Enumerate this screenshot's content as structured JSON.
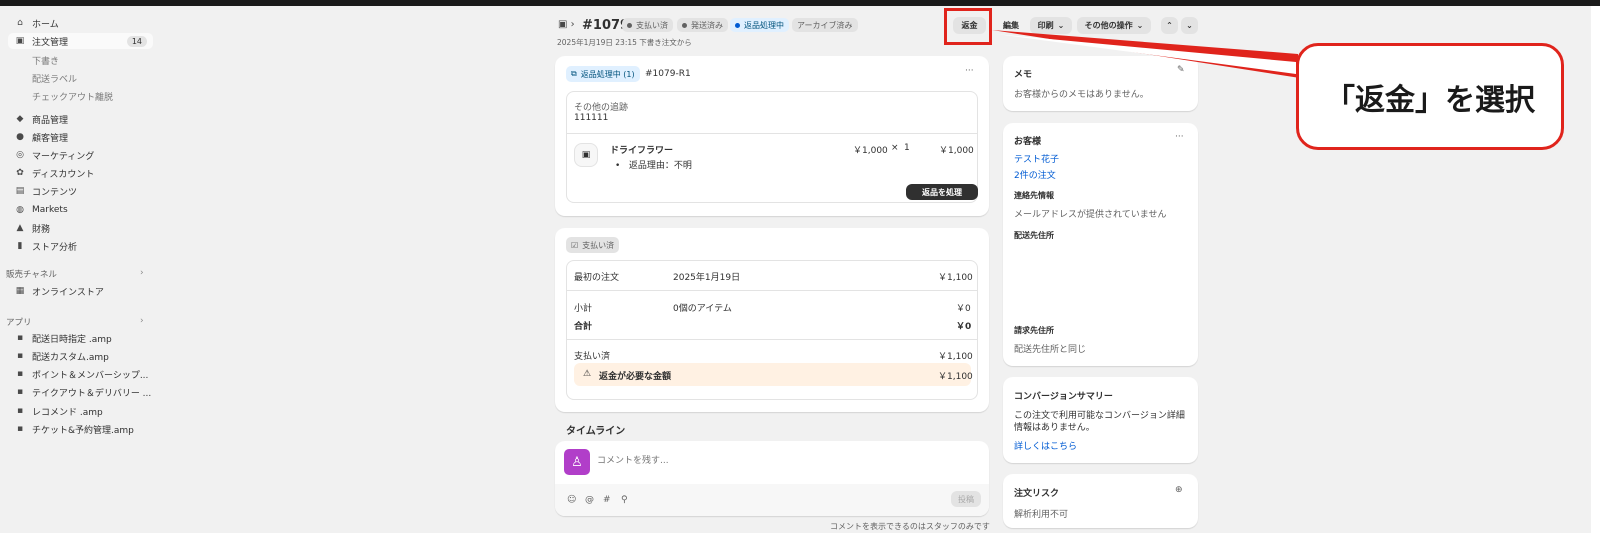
{
  "sidebar": {
    "items": [
      {
        "label": "ホーム",
        "icon": "home-icon"
      },
      {
        "label": "注文管理",
        "icon": "inbox-icon",
        "badge": "14"
      },
      {
        "label": "商品管理",
        "icon": "tag-icon"
      },
      {
        "label": "顧客管理",
        "icon": "person-icon"
      },
      {
        "label": "マーケティング",
        "icon": "target-icon"
      },
      {
        "label": "ディスカウント",
        "icon": "discount-icon"
      },
      {
        "label": "コンテンツ",
        "icon": "content-icon"
      },
      {
        "label": "Markets",
        "icon": "globe-icon"
      },
      {
        "label": "財務",
        "icon": "bank-icon"
      },
      {
        "label": "ストア分析",
        "icon": "chart-bar-icon"
      }
    ],
    "order_subitems": [
      "下書き",
      "配送ラベル",
      "チェックアウト離脱"
    ],
    "sales_channels_label": "販売チャネル",
    "online_store": "オンラインストア",
    "apps_label": "アプリ",
    "apps": [
      "配送日時指定 .amp",
      "配送カスタム.amp",
      "ポイント＆メンバーシップ...",
      "テイクアウト＆デリバリー ...",
      "レコメンド .amp",
      "チケット&予約管理.amp"
    ]
  },
  "header": {
    "order_number": "#1079",
    "pills": [
      "支払い済",
      "発送済み",
      "返品処理中",
      "アーカイブ済み"
    ],
    "subtitle": "2025年1月19日 23:15 下書き注文から",
    "buttons": {
      "refund": "返金",
      "edit": "編集",
      "print": "印刷",
      "more": "その他の操作"
    }
  },
  "return_card": {
    "badge": "返品処理中 (1)",
    "return_id": "#1079-R1",
    "tracking_label": "その他の追跡",
    "tracking_value": "111111",
    "item_name": "ドライフラワー",
    "item_price": "￥1,000",
    "item_times": "×",
    "item_qty": "1",
    "item_total": "￥1,000",
    "reason": "返品理由：不明",
    "process_button": "返品を処理"
  },
  "payment_card": {
    "badge": "支払い済",
    "rows": [
      {
        "label": "最初の注文",
        "mid": "2025年1月19日",
        "value": "￥1,100"
      },
      {
        "label": "小計",
        "mid": "0個のアイテム",
        "value": "￥0"
      },
      {
        "label": "合計",
        "mid": "",
        "value": "￥0"
      },
      {
        "label": "支払い済",
        "mid": "",
        "value": "￥1,100"
      }
    ],
    "refund_due_label": "返金が必要な金額",
    "refund_due_value": "￥1,100"
  },
  "timeline": {
    "title": "タイムライン",
    "placeholder": "コメントを残す...",
    "post_button": "投稿",
    "note": "コメントを表示できるのはスタッフのみです"
  },
  "memo": {
    "title": "メモ",
    "text": "お客様からのメモはありません。"
  },
  "customer": {
    "title": "お客様",
    "name": "テスト花子",
    "orders": "2件の注文",
    "contact_title": "連絡先情報",
    "contact_text": "メールアドレスが提供されていません",
    "shipping_title": "配送先住所",
    "billing_title": "請求先住所",
    "billing_text": "配送先住所と同じ"
  },
  "conversion": {
    "title": "コンバージョンサマリー",
    "line1": "この注文で利用可能なコンバージョン詳細",
    "line2": "情報はありません。",
    "link": "詳しくはこちら"
  },
  "risk": {
    "title": "注文リスク",
    "text": "解析利用不可"
  },
  "annotation": {
    "callout": "「返金」を選択",
    "color": "#e0241c"
  }
}
